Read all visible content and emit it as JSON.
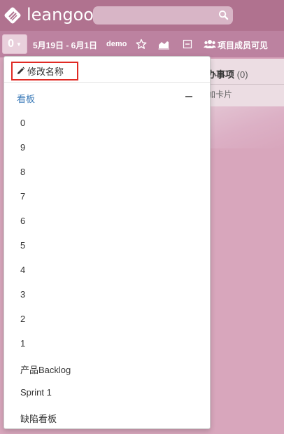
{
  "header": {
    "logo_text": "leangoo",
    "search": {
      "value": "",
      "placeholder": ""
    }
  },
  "toolbar": {
    "board_number": "0",
    "date_range": "5月19日 - 6月1日",
    "board_name": "demo",
    "visibility_label": "项目成员可见"
  },
  "background_list": {
    "title": "办事项",
    "count": "(0)",
    "add_card": "加卡片"
  },
  "menu": {
    "rename_label": "修改名称",
    "section_title": "看板",
    "items": [
      "0",
      "9",
      "8",
      "7",
      "6",
      "5",
      "4",
      "3",
      "2",
      "1",
      "产品Backlog",
      "Sprint 1",
      "缺陷看板"
    ]
  },
  "colors": {
    "header_bg": "#b0728f",
    "toolbar_bg": "#bc82a0",
    "page_bg": "#d8a6bc",
    "section_link": "#3a7ab8",
    "highlight_border": "#e02a24"
  }
}
